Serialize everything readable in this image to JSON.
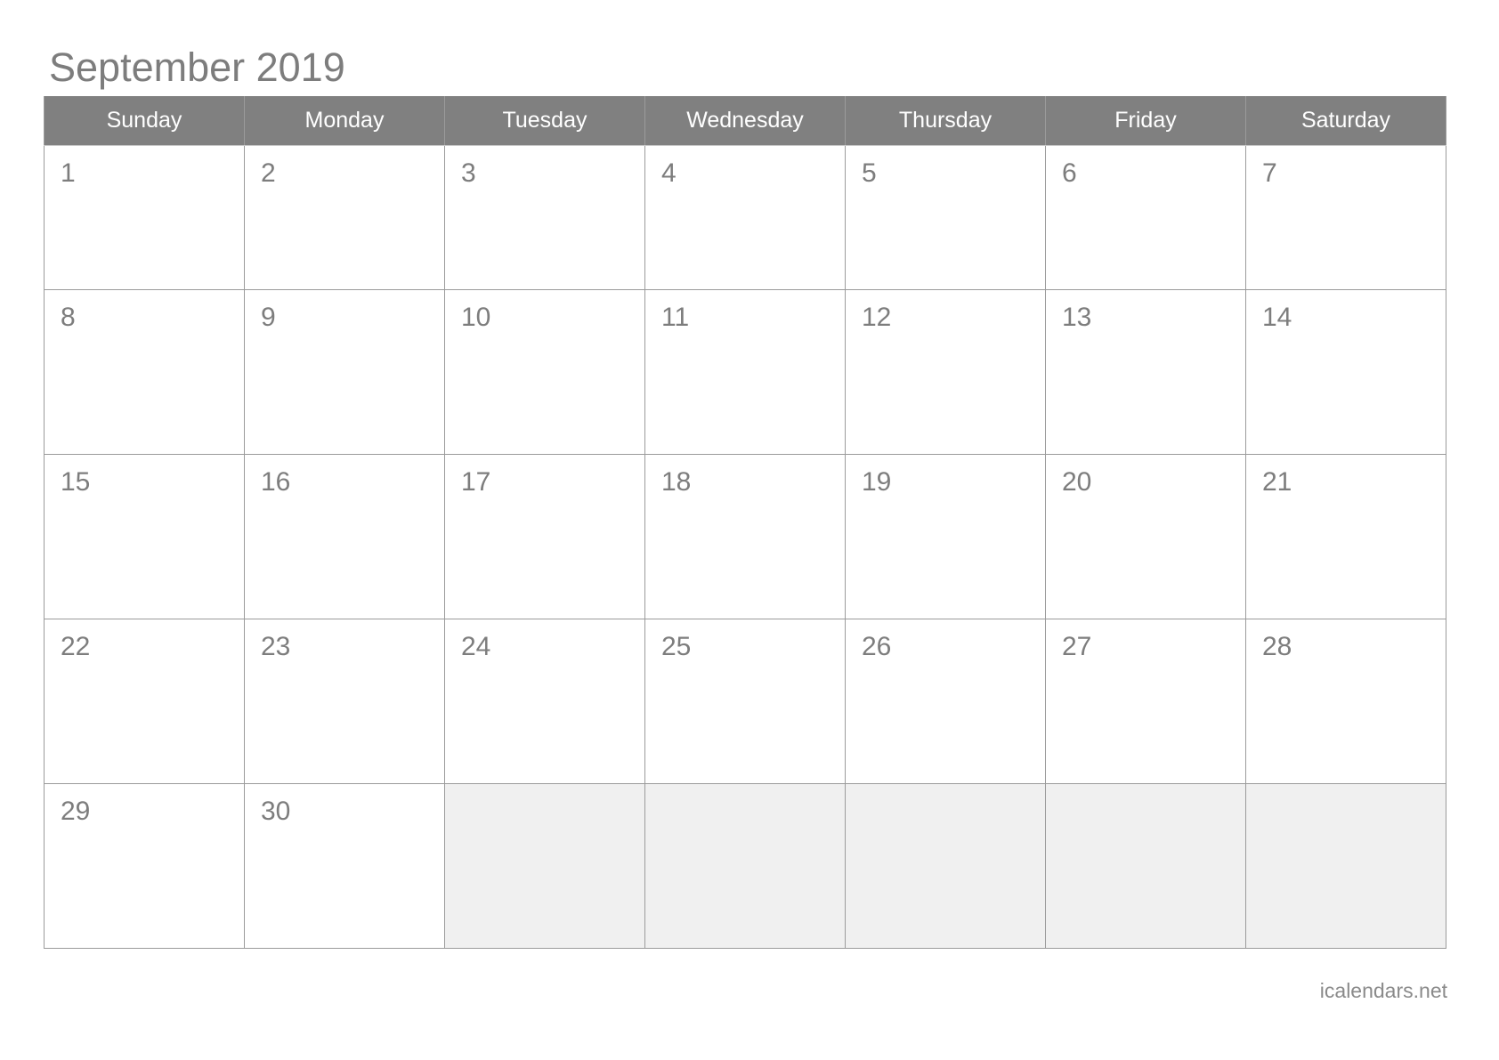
{
  "calendar": {
    "title": "September 2019",
    "month": "September",
    "year": "2019",
    "weekday_headers": [
      "Sunday",
      "Monday",
      "Tuesday",
      "Wednesday",
      "Thursday",
      "Friday",
      "Saturday"
    ],
    "weeks": [
      [
        "1",
        "2",
        "3",
        "4",
        "5",
        "6",
        "7"
      ],
      [
        "8",
        "9",
        "10",
        "11",
        "12",
        "13",
        "14"
      ],
      [
        "15",
        "16",
        "17",
        "18",
        "19",
        "20",
        "21"
      ],
      [
        "22",
        "23",
        "24",
        "25",
        "26",
        "27",
        "28"
      ],
      [
        "29",
        "30",
        "",
        "",
        "",
        "",
        ""
      ]
    ],
    "footer": "icalendars.net",
    "colors": {
      "header_background": "#808080",
      "header_text": "#ffffff",
      "day_number_text": "#7d7d7d",
      "title_text": "#7d7d7d",
      "grid_border": "#9b9b9b",
      "empty_cell_background": "#f0f0f0",
      "page_background": "#ffffff",
      "footer_text": "#8a8a8a"
    }
  }
}
